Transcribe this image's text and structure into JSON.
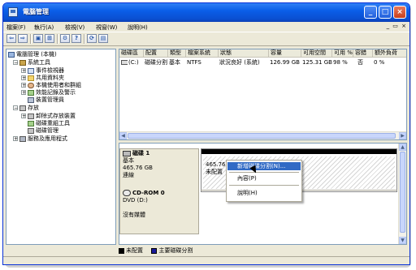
{
  "window": {
    "title": "電腦管理"
  },
  "titlebar_buttons": [
    "_",
    "□",
    "×"
  ],
  "menubar": {
    "items": [
      "檔案(F)",
      "執行(A)",
      "檢視(V)",
      "視窗(W)",
      "說明(H)"
    ],
    "mdi_controls": "_ ▭ ×"
  },
  "toolbar": {
    "buttons": [
      "back-arrow-icon",
      "forward-arrow-icon",
      "up-icon",
      "show-tree-icon",
      "properties-icon",
      "help-icon",
      "refresh-icon",
      "export-icon"
    ],
    "glyphs": [
      "⇦",
      "⇨",
      "▣",
      "⊞",
      "⚙",
      "?",
      "⟳",
      "▤"
    ]
  },
  "tree": {
    "items": [
      {
        "label": "電腦管理 (本機)",
        "icon": "computer-icon",
        "level": 0,
        "expander": ""
      },
      {
        "label": "系統工具",
        "icon": "tools-icon",
        "level": 1,
        "expander": "−"
      },
      {
        "label": "事件檢視器",
        "icon": "event-viewer-icon",
        "level": 2,
        "expander": "+"
      },
      {
        "label": "共用資料夾",
        "icon": "shared-folder-icon",
        "level": 2,
        "expander": "+"
      },
      {
        "label": "本機使用者和群組",
        "icon": "users-icon",
        "level": 2,
        "expander": "+"
      },
      {
        "label": "效能記錄及警示",
        "icon": "performance-icon",
        "level": 2,
        "expander": "+"
      },
      {
        "label": "裝置管理員",
        "icon": "device-manager-icon",
        "level": 2,
        "expander": ""
      },
      {
        "label": "存放",
        "icon": "storage-icon",
        "level": 1,
        "expander": "−"
      },
      {
        "label": "卸除式存放裝置",
        "icon": "removable-storage-icon",
        "level": 2,
        "expander": "+"
      },
      {
        "label": "磁碟重組工具",
        "icon": "defrag-icon",
        "level": 2,
        "expander": ""
      },
      {
        "label": "磁碟管理",
        "icon": "disk-management-icon",
        "level": 2,
        "expander": ""
      },
      {
        "label": "服務及應用程式",
        "icon": "services-icon",
        "level": 1,
        "expander": "+"
      }
    ]
  },
  "volume_list": {
    "columns": [
      "磁碟區",
      "配置",
      "類型",
      "檔案系統",
      "狀態",
      "容量",
      "可用空間",
      "可用 %",
      "容錯",
      "額外負荷"
    ],
    "rows": [
      [
        "(C:)",
        "磁碟分割",
        "基本",
        "NTFS",
        "狀況良好 (系統)",
        "126.99 GB",
        "125.31 GB",
        "98 %",
        "否",
        "0 %"
      ]
    ]
  },
  "disks": [
    {
      "name": "磁碟 1",
      "type": "基本",
      "size": "465.76 GB",
      "status": "連線",
      "partition": {
        "size": "465.76 GB",
        "status": "未配置"
      }
    },
    {
      "name": "CD-ROM 0",
      "type": "DVD (D:)",
      "size": "",
      "status": "沒有媒體"
    }
  ],
  "legend": {
    "unallocated": "未配置",
    "primary": "主要磁碟分割",
    "unallocated_color": "#000000",
    "primary_color": "#1a1a9a"
  },
  "context_menu": {
    "items": [
      "新增磁碟分割(N)...",
      "內容(P)",
      "說明(H)"
    ],
    "highlight_color": "#316ac5"
  }
}
